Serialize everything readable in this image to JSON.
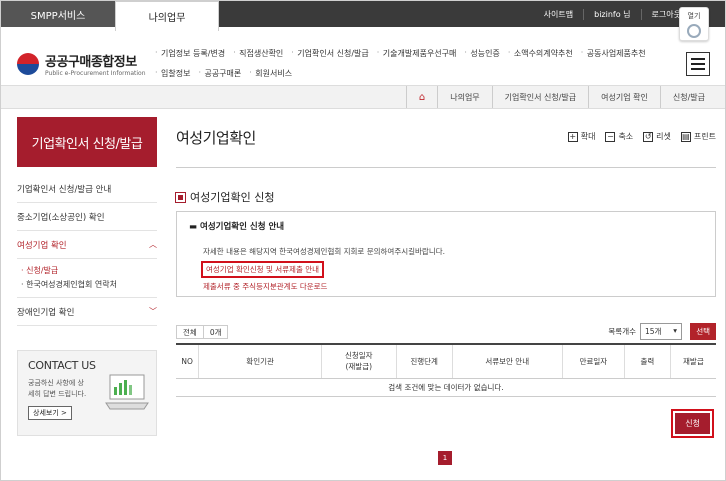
{
  "topbar": {
    "tabs": [
      "SMPP서비스",
      "나의업무"
    ],
    "util_links": [
      "사이트맵",
      "bizinfo 님",
      "로그아웃"
    ],
    "open_label": "열기"
  },
  "logo": {
    "name": "공공구매종합정보",
    "sub": "Public e-Procurement Information"
  },
  "gnb": {
    "row1": [
      "기업정보 등록/변경",
      "직접생산확인",
      "기업확인서 신청/발급",
      "기술개발제품우선구매",
      "성능인증",
      "소액수의계약추천",
      "공동사업제품추천"
    ],
    "row2": [
      "입찰정보",
      "공공구매론",
      "회원서비스"
    ]
  },
  "breadcrumb": [
    "나의업무",
    "기업확인서 신청/발급",
    "여성기업 확인",
    "신청/발급"
  ],
  "sidebar": {
    "title": "기업확인서 신청/발급",
    "items": [
      {
        "label": "기업확인서 신청/발급 안내"
      },
      {
        "label": "중소기업(소상공인) 확인"
      },
      {
        "label": "여성기업 확인"
      },
      {
        "label": "장애인기업 확인"
      }
    ],
    "sub": [
      "신청/발급",
      "한국여성경제인협회 연락처"
    ],
    "contact": {
      "title": "CONTACT US",
      "text": "궁금하신 사항에 상세히 답변 드립니다.",
      "button": "상세보기 >"
    }
  },
  "main": {
    "title": "여성기업확인",
    "tools": [
      "확대",
      "축소",
      "리셋",
      "프린트"
    ],
    "section_title": "여성기업확인 신청",
    "info": {
      "title": "여성기업확인 신청 안내",
      "desc": "자세한 내용은 해당지역 한국여성경제인협회 지회로 문의하여주시길바랍니다.",
      "link1": "여성기업 확인신청 및 서류제출 안내",
      "link2": "제출서류 중 주식등지분관계도 다운로드"
    },
    "count": {
      "label": "전체",
      "value": "0개"
    },
    "per_page": {
      "label": "목록개수",
      "value": "15개"
    },
    "select_btn": "선택",
    "table": {
      "headers": [
        "NO",
        "확인기관",
        "신청일자\n(재발급)",
        "진행단계",
        "서류보안 안내",
        "만료일자",
        "출력",
        "재발급"
      ],
      "empty": "검색 조건에 맞는 데이터가 없습니다."
    },
    "apply_btn": "신청",
    "page": "1"
  },
  "colors": {
    "brand": "#a51d2d",
    "highlight": "#d1101b"
  }
}
